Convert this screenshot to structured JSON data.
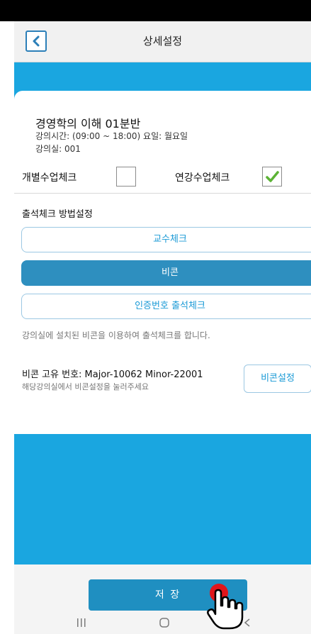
{
  "header": {
    "title": "상세설정"
  },
  "course": {
    "title": "경영학의 이해   01분반",
    "time_line": "강의시간: (09:00 ~ 18:00)  요일: 월요일",
    "room_line": "강의실: 001"
  },
  "checks": {
    "individual_label": "개별수업체크",
    "individual_checked": false,
    "consecutive_label": "연강수업체크",
    "consecutive_checked": true
  },
  "attendance": {
    "section_label": "출석체크 방법설정",
    "methods": [
      {
        "label": "교수체크",
        "selected": false
      },
      {
        "label": "비콘",
        "selected": true
      },
      {
        "label": "인증번호 출석체크",
        "selected": false
      }
    ],
    "description": "강의실에 설치된 비콘을 이용하여 출석체크를 합니다."
  },
  "beacon": {
    "id_line": "비콘 고유 번호:  Major-10062   Minor-22001",
    "hint": "해당강의실에서 비콘설정을 눌러주세요",
    "settings_label": "비콘설정"
  },
  "footer": {
    "save_label": "저 장"
  },
  "colors": {
    "accent_blue": "#1aa6e0",
    "button_blue": "#1f8fc1",
    "selected_method": "#2e8fbf",
    "check_green": "#5cb335",
    "tap_indicator": "#e0161b"
  }
}
